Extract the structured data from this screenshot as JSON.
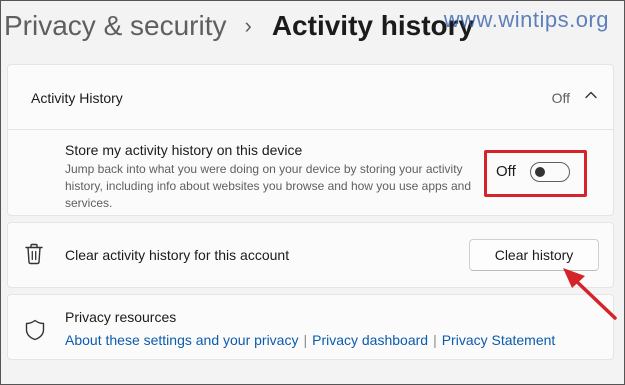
{
  "breadcrumb": {
    "parent": "Privacy & security",
    "separator": "›",
    "current": "Activity history"
  },
  "watermark": "www.wintips.org",
  "activity_history": {
    "title": "Activity History",
    "status": "Off",
    "icon": "chevron-up-icon",
    "store_option": {
      "title": "Store my activity history on this device",
      "description": "Jump back into what you were doing on your device by storing your activity history, including info about websites you browse and how you use apps and services.",
      "toggle_label": "Off",
      "toggle_on": false
    }
  },
  "clear_history": {
    "icon": "trash-icon",
    "label": "Clear activity history for this account",
    "button_label": "Clear history"
  },
  "privacy_resources": {
    "icon": "shield-icon",
    "title": "Privacy resources",
    "links": [
      "About these settings and your privacy",
      "Privacy dashboard",
      "Privacy Statement"
    ],
    "link_separator": "|"
  },
  "colors": {
    "highlight": "#d5232a",
    "link": "#0b5cad",
    "watermark": "#2d5aa8"
  }
}
